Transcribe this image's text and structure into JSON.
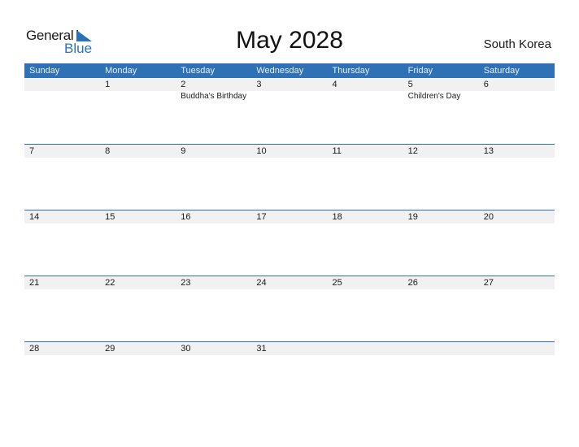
{
  "brand": {
    "word1": "General",
    "word2": "Blue",
    "accent": "#2e71b5"
  },
  "title": "May 2028",
  "country": "South Korea",
  "weekdays": [
    "Sunday",
    "Monday",
    "Tuesday",
    "Wednesday",
    "Thursday",
    "Friday",
    "Saturday"
  ],
  "weeks": [
    [
      {
        "d": ""
      },
      {
        "d": "1"
      },
      {
        "d": "2",
        "ev": "Buddha's Birthday"
      },
      {
        "d": "3"
      },
      {
        "d": "4"
      },
      {
        "d": "5",
        "ev": "Children's Day"
      },
      {
        "d": "6"
      }
    ],
    [
      {
        "d": "7"
      },
      {
        "d": "8"
      },
      {
        "d": "9"
      },
      {
        "d": "10"
      },
      {
        "d": "11"
      },
      {
        "d": "12"
      },
      {
        "d": "13"
      }
    ],
    [
      {
        "d": "14"
      },
      {
        "d": "15"
      },
      {
        "d": "16"
      },
      {
        "d": "17"
      },
      {
        "d": "18"
      },
      {
        "d": "19"
      },
      {
        "d": "20"
      }
    ],
    [
      {
        "d": "21"
      },
      {
        "d": "22"
      },
      {
        "d": "23"
      },
      {
        "d": "24"
      },
      {
        "d": "25"
      },
      {
        "d": "26"
      },
      {
        "d": "27"
      }
    ],
    [
      {
        "d": "28"
      },
      {
        "d": "29"
      },
      {
        "d": "30"
      },
      {
        "d": "31"
      },
      {
        "d": ""
      },
      {
        "d": ""
      },
      {
        "d": ""
      }
    ]
  ]
}
